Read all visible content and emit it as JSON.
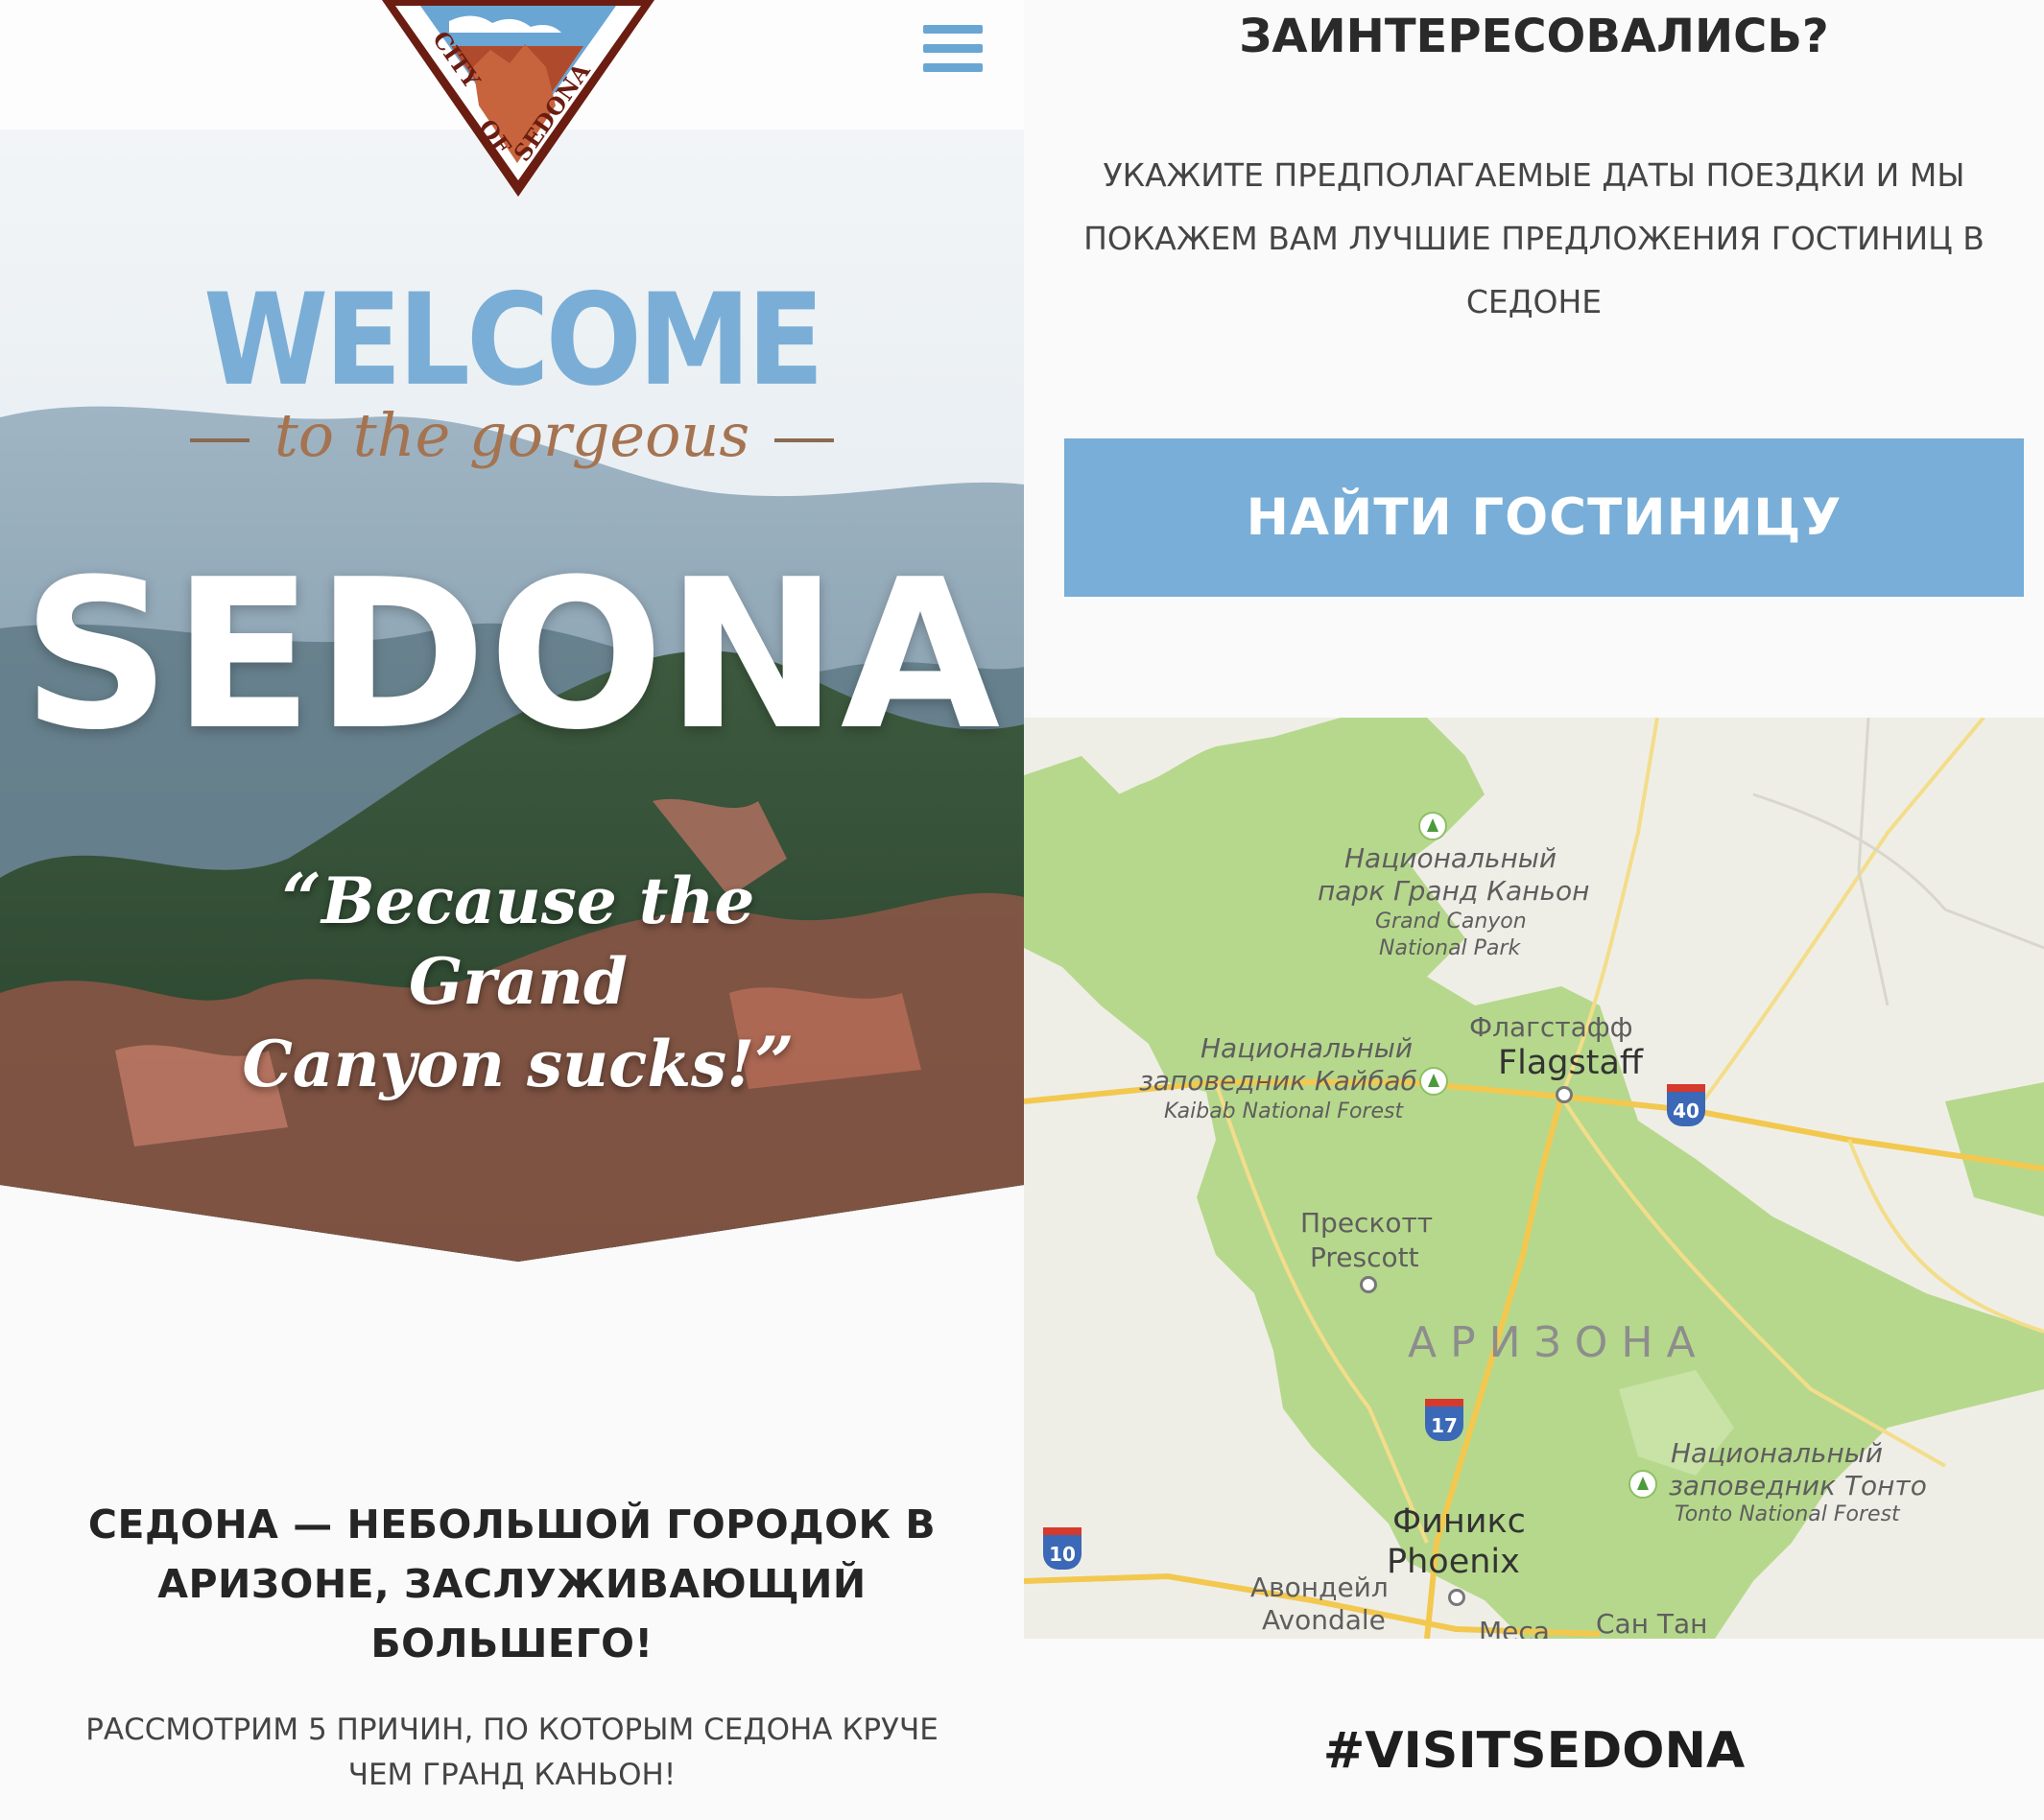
{
  "left": {
    "logo": {
      "text": "CITY OF SEDONA"
    },
    "menu": {
      "icon": "hamburger-menu-icon"
    },
    "hero": {
      "welcome": "WELCOME",
      "subtitle": "to the gorgeous",
      "title": "SEDONA",
      "quote_line1": "Because the Grand",
      "quote_line2": "Canyon sucks!"
    },
    "headline_line1": "СЕДОНА — НЕБОЛЬШОЙ ГОРОДОК В",
    "headline_line2": "АРИЗОНЕ, ЗАСЛУЖИВАЮЩИЙ БОЛЬШЕГО!",
    "subline_line1": "РАССМОТРИМ 5 ПРИЧИН, ПО КОТОРЫМ СЕДОНА КРУЧЕ",
    "subline_line2": "ЧЕМ ГРАНД КАНЬОН!"
  },
  "right": {
    "title": "ЗАИНТЕРЕСОВАЛИСЬ?",
    "desc_line1": "УКАЖИТЕ ПРЕДПОЛАГАЕМЫЕ ДАТЫ ПОЕЗДКИ И МЫ",
    "desc_line2": "ПОКАЖЕМ ВАМ ЛУЧШИЕ ПРЕДЛОЖЕНИЯ ГОСТИНИЦ В",
    "desc_line3": "СЕДОНЕ",
    "cta_label": "НАЙТИ ГОСТИНИЦУ",
    "map": {
      "grand_canyon_ru1": "Национальный",
      "grand_canyon_ru2": "парк Гранд Каньон",
      "grand_canyon_en1": "Grand Canyon",
      "grand_canyon_en2": "National Park",
      "flagstaff_ru": "Флагстафф",
      "flagstaff_en": "Flagstaff",
      "kaibab_ru1": "Национальный",
      "kaibab_ru2": "заповедник Кайбаб",
      "kaibab_en": "Kaibab National Forest",
      "prescott_ru": "Прескотт",
      "prescott_en": "Prescott",
      "state": "АРИЗОНА",
      "tonto_ru1": "Национальный",
      "tonto_ru2": "заповедник Тонто",
      "tonto_en": "Tonto National Forest",
      "phoenix_ru": "Финикс",
      "phoenix_en": "Phoenix",
      "avondale_ru": "Авондейл",
      "avondale_en": "Avondale",
      "mesa_ru": "Меса",
      "santan_ru": "Сан Тан",
      "route_40": "40",
      "route_17": "17",
      "route_10": "10"
    },
    "hashtag": "#VISITSEDONA"
  }
}
